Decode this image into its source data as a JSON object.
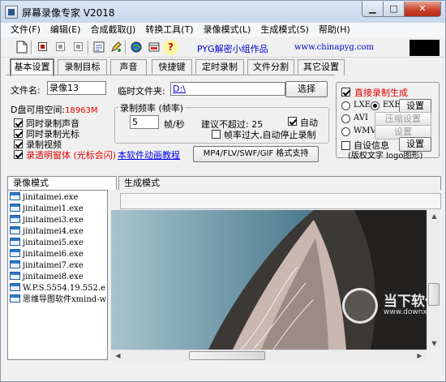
{
  "window": {
    "title": "屏幕录像专家 V2018"
  },
  "menu": [
    "文件(F)",
    "编辑(E)",
    "合成截取(J)",
    "转换工具(T)",
    "录像模式(L)",
    "生成模式(S)",
    "帮助(H)"
  ],
  "toolbar": {
    "icons": [
      "new-file-icon",
      "record-icon",
      "pause-icon",
      "stop-icon",
      "settings-icon",
      "pen-tool-icon",
      "globe-icon",
      "movie-clip-icon",
      "help-icon"
    ],
    "help_glyph": "?",
    "pyg_text": "PYG解密小组作品",
    "url_text": "www.chinapyg.com"
  },
  "tabs": [
    "基本设置",
    "录制目标",
    "声音",
    "快捷键",
    "定时录制",
    "文件分割",
    "其它设置"
  ],
  "basic": {
    "filename_label": "文件名:",
    "filename_value": "录像13",
    "tempdir_label": "临时文件夹:",
    "tempdir_value": "D:\\",
    "choose_button": "选择",
    "disk_label": "D盘可用空间:",
    "disk_value": "18963M",
    "opt_sound": "同时录制声音",
    "opt_cursor": "同时录制光标",
    "opt_video": "录制视频",
    "opt_transparent": "录透明窗体 (光标会闪)",
    "tutorial_link": "本软件动画教程",
    "format_button": "MP4/FLV/SWF/GIF  格式支持"
  },
  "framerate": {
    "title": "录制频率 (帧率)",
    "value": "5",
    "unit": "帧/秒",
    "suggest_label": "建议不超过:",
    "suggest_value": "25",
    "auto_label": "自动",
    "auto_stop": "帧率过大,自动停止录制"
  },
  "output": {
    "direct_label": "直接录制生成",
    "lxe": "LXE",
    "exe": "EXE",
    "avi": "AVI",
    "wmv": "WMV",
    "settings_button": "设置",
    "compress_button": "压缩设置",
    "settings_button_disabled": "设置",
    "custom_info": "自设信息",
    "settings_button_2": "设置",
    "copyright_text": "(版权文字 logo图形)"
  },
  "modes": {
    "record_mode": "录像模式",
    "generate_mode": "生成模式"
  },
  "files": [
    "jinitaimei.exe",
    "jinitaimei1.exe",
    "jinitaimei3.exe",
    "jinitaimei4.exe",
    "jinitaimei5.exe",
    "jinitaimei6.exe",
    "jinitaimei7.exe",
    "jinitaimei8.exe",
    "W.P.S.5554.19.552.e",
    "思维导图软件xmind-w"
  ],
  "watermark": {
    "name": "当下软件园",
    "url": "www.downxia.com"
  }
}
